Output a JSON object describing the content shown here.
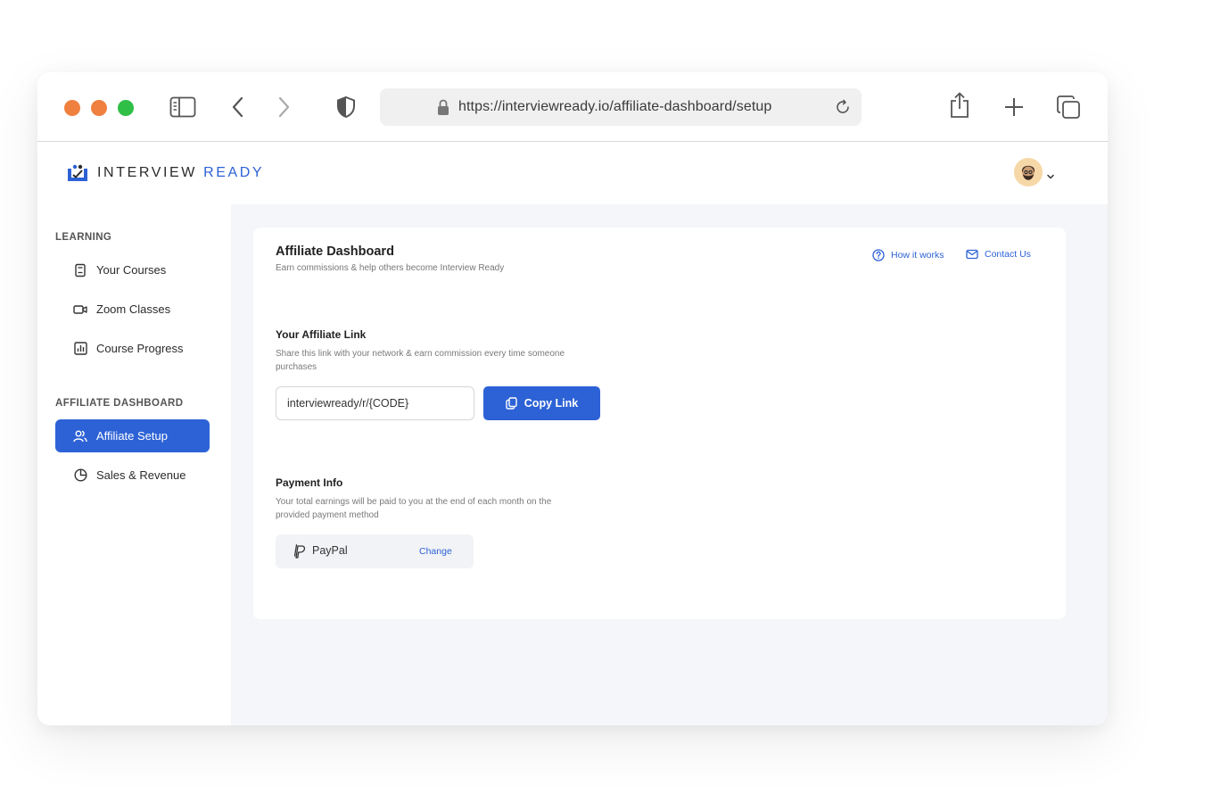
{
  "browser": {
    "url": "https://interviewready.io/affiliate-dashboard/setup"
  },
  "brand": {
    "name_part1": "INTERVIEW",
    "name_part2": "READY",
    "accent_color": "#2d62d6"
  },
  "sidebar": {
    "learning_label": "LEARNING",
    "learning_items": [
      {
        "label": "Your Courses",
        "icon": "book-icon"
      },
      {
        "label": "Zoom Classes",
        "icon": "video-icon"
      },
      {
        "label": "Course Progress",
        "icon": "chart-icon"
      }
    ],
    "affiliate_label": "AFFILIATE DASHBOARD",
    "affiliate_items": [
      {
        "label": "Affiliate Setup",
        "icon": "users-icon",
        "active": true
      },
      {
        "label": "Sales & Revenue",
        "icon": "pie-chart-icon",
        "active": false
      }
    ]
  },
  "card": {
    "title": "Affiliate Dashboard",
    "subtitle": "Earn commissions & help others become Interview Ready",
    "how_it_works": "How it works",
    "contact_us": "Contact Us",
    "link_section": {
      "title": "Your Affiliate Link",
      "description": "Share this link with your network & earn commission every time someone purchases",
      "link_value": "interviewready/r/{CODE}",
      "copy_label": "Copy Link"
    },
    "payment_section": {
      "title": "Payment Info",
      "description": "Your total earnings will be paid to you at the end of each month on the provided payment method",
      "method": "PayPal",
      "change_label": "Change"
    }
  }
}
